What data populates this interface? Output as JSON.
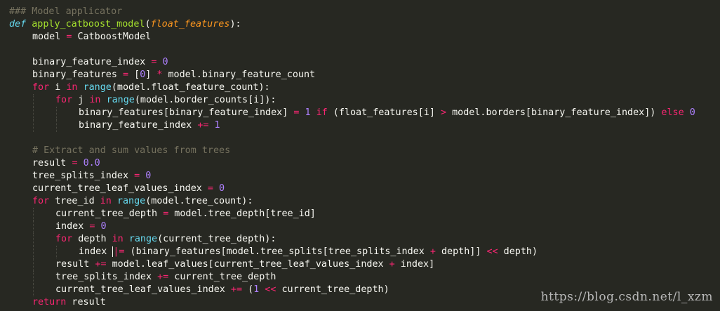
{
  "editor": {
    "lines": [
      {
        "indent": 0,
        "tokens": [
          {
            "t": "### Model applicator",
            "c": "comment"
          }
        ]
      },
      {
        "indent": 0,
        "tokens": [
          {
            "t": "def",
            "c": "def"
          },
          {
            "t": " "
          },
          {
            "t": "apply_catboost_model",
            "c": "fn"
          },
          {
            "t": "("
          },
          {
            "t": "float_features",
            "c": "param"
          },
          {
            "t": "):"
          }
        ]
      },
      {
        "indent": 1,
        "tokens": [
          {
            "t": "model "
          },
          {
            "t": "=",
            "c": "op"
          },
          {
            "t": " CatboostModel"
          }
        ]
      },
      {
        "indent": 1,
        "tokens": []
      },
      {
        "indent": 1,
        "tokens": [
          {
            "t": "binary_feature_index "
          },
          {
            "t": "=",
            "c": "op"
          },
          {
            "t": " "
          },
          {
            "t": "0",
            "c": "num"
          }
        ]
      },
      {
        "indent": 1,
        "tokens": [
          {
            "t": "binary_features "
          },
          {
            "t": "=",
            "c": "op"
          },
          {
            "t": " ["
          },
          {
            "t": "0",
            "c": "num"
          },
          {
            "t": "] "
          },
          {
            "t": "*",
            "c": "op"
          },
          {
            "t": " model.binary_feature_count"
          }
        ]
      },
      {
        "indent": 1,
        "tokens": [
          {
            "t": "for",
            "c": "kw"
          },
          {
            "t": " i "
          },
          {
            "t": "in",
            "c": "kw"
          },
          {
            "t": " "
          },
          {
            "t": "range",
            "c": "builtin"
          },
          {
            "t": "(model.float_feature_count):"
          }
        ]
      },
      {
        "indent": 2,
        "tokens": [
          {
            "t": "for",
            "c": "kw"
          },
          {
            "t": " j "
          },
          {
            "t": "in",
            "c": "kw"
          },
          {
            "t": " "
          },
          {
            "t": "range",
            "c": "builtin"
          },
          {
            "t": "(model.border_counts[i]):"
          }
        ]
      },
      {
        "indent": 3,
        "tokens": [
          {
            "t": "binary_features[binary_feature_index] "
          },
          {
            "t": "=",
            "c": "op"
          },
          {
            "t": " "
          },
          {
            "t": "1",
            "c": "num"
          },
          {
            "t": " "
          },
          {
            "t": "if",
            "c": "kw"
          },
          {
            "t": " (float_features[i] "
          },
          {
            "t": ">",
            "c": "op"
          },
          {
            "t": " model.borders[binary_feature_index]) "
          },
          {
            "t": "else",
            "c": "kw"
          },
          {
            "t": " "
          },
          {
            "t": "0",
            "c": "num"
          }
        ]
      },
      {
        "indent": 3,
        "tokens": [
          {
            "t": "binary_feature_index "
          },
          {
            "t": "+=",
            "c": "op"
          },
          {
            "t": " "
          },
          {
            "t": "1",
            "c": "num"
          }
        ]
      },
      {
        "indent": 1,
        "tokens": []
      },
      {
        "indent": 1,
        "tokens": [
          {
            "t": "# Extract and sum values from trees",
            "c": "comment"
          }
        ]
      },
      {
        "indent": 1,
        "tokens": [
          {
            "t": "result "
          },
          {
            "t": "=",
            "c": "op"
          },
          {
            "t": " "
          },
          {
            "t": "0.0",
            "c": "num"
          }
        ]
      },
      {
        "indent": 1,
        "tokens": [
          {
            "t": "tree_splits_index "
          },
          {
            "t": "=",
            "c": "op"
          },
          {
            "t": " "
          },
          {
            "t": "0",
            "c": "num"
          }
        ]
      },
      {
        "indent": 1,
        "tokens": [
          {
            "t": "current_tree_leaf_values_index "
          },
          {
            "t": "=",
            "c": "op"
          },
          {
            "t": " "
          },
          {
            "t": "0",
            "c": "num"
          }
        ]
      },
      {
        "indent": 1,
        "tokens": [
          {
            "t": "for",
            "c": "kw"
          },
          {
            "t": " tree_id "
          },
          {
            "t": "in",
            "c": "kw"
          },
          {
            "t": " "
          },
          {
            "t": "range",
            "c": "builtin"
          },
          {
            "t": "(model.tree_count):"
          }
        ]
      },
      {
        "indent": 2,
        "tokens": [
          {
            "t": "current_tree_depth "
          },
          {
            "t": "=",
            "c": "op"
          },
          {
            "t": " model.tree_depth[tree_id]"
          }
        ]
      },
      {
        "indent": 2,
        "tokens": [
          {
            "t": "index "
          },
          {
            "t": "=",
            "c": "op"
          },
          {
            "t": " "
          },
          {
            "t": "0",
            "c": "num"
          }
        ]
      },
      {
        "indent": 2,
        "tokens": [
          {
            "t": "for",
            "c": "kw"
          },
          {
            "t": " depth "
          },
          {
            "t": "in",
            "c": "kw"
          },
          {
            "t": " "
          },
          {
            "t": "range",
            "c": "builtin"
          },
          {
            "t": "(current_tree_depth):"
          }
        ]
      },
      {
        "indent": 3,
        "tokens": [
          {
            "t": "index "
          },
          {
            "t": "|=",
            "c": "op",
            "cursor": true
          },
          {
            "t": " (binary_features[model.tree_splits[tree_splits_index "
          },
          {
            "t": "+",
            "c": "op"
          },
          {
            "t": " depth]] "
          },
          {
            "t": "<<",
            "c": "op"
          },
          {
            "t": " depth)"
          }
        ]
      },
      {
        "indent": 2,
        "tokens": [
          {
            "t": "result "
          },
          {
            "t": "+=",
            "c": "op"
          },
          {
            "t": " model.leaf_values[current_tree_leaf_values_index "
          },
          {
            "t": "+",
            "c": "op"
          },
          {
            "t": " index]"
          }
        ]
      },
      {
        "indent": 2,
        "tokens": [
          {
            "t": "tree_splits_index "
          },
          {
            "t": "+=",
            "c": "op"
          },
          {
            "t": " current_tree_depth"
          }
        ]
      },
      {
        "indent": 2,
        "tokens": [
          {
            "t": "current_tree_leaf_values_index "
          },
          {
            "t": "+=",
            "c": "op"
          },
          {
            "t": " ("
          },
          {
            "t": "1",
            "c": "num"
          },
          {
            "t": " "
          },
          {
            "t": "<<",
            "c": "op"
          },
          {
            "t": " current_tree_depth)"
          }
        ]
      },
      {
        "indent": 1,
        "tokens": [
          {
            "t": "return",
            "c": "kw"
          },
          {
            "t": " result"
          }
        ]
      }
    ]
  },
  "watermark": {
    "text": "https://blog.csdn.net/l_xzm"
  },
  "colors": {
    "background": "#272822",
    "text": "#f8f8f2",
    "keyword": "#f92672",
    "function": "#a6e22e",
    "parameter": "#fd971f",
    "number": "#ae81ff",
    "builtin": "#66d9ef",
    "comment": "#75715e"
  }
}
